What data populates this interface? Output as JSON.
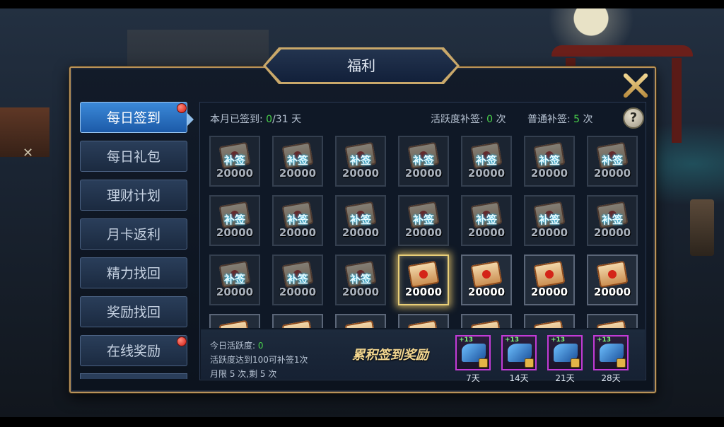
{
  "title": "福利",
  "sidebar": {
    "items": [
      {
        "label": "每日签到",
        "active": true,
        "red_dot": true
      },
      {
        "label": "每日礼包",
        "active": false,
        "red_dot": false
      },
      {
        "label": "理财计划",
        "active": false,
        "red_dot": false
      },
      {
        "label": "月卡返利",
        "active": false,
        "red_dot": false
      },
      {
        "label": "精力找回",
        "active": false,
        "red_dot": false
      },
      {
        "label": "奖励找回",
        "active": false,
        "red_dot": false
      },
      {
        "label": "在线奖励",
        "active": false,
        "red_dot": true
      }
    ]
  },
  "header": {
    "signed_label": "本月已签到:",
    "signed_value": "0",
    "signed_suffix": "/31 天",
    "activity_label": "活跃度补签:",
    "activity_value": "0",
    "activity_unit": "次",
    "normal_label": "普通补签:",
    "normal_value": "5",
    "normal_unit": "次",
    "help": "?"
  },
  "calendar": {
    "missed_overlay": "补签",
    "cells": [
      {
        "amount": "20000",
        "state": "missed"
      },
      {
        "amount": "20000",
        "state": "missed"
      },
      {
        "amount": "20000",
        "state": "missed"
      },
      {
        "amount": "20000",
        "state": "missed"
      },
      {
        "amount": "20000",
        "state": "missed"
      },
      {
        "amount": "20000",
        "state": "missed"
      },
      {
        "amount": "20000",
        "state": "missed"
      },
      {
        "amount": "20000",
        "state": "missed"
      },
      {
        "amount": "20000",
        "state": "missed"
      },
      {
        "amount": "20000",
        "state": "missed"
      },
      {
        "amount": "20000",
        "state": "missed"
      },
      {
        "amount": "20000",
        "state": "missed"
      },
      {
        "amount": "20000",
        "state": "missed"
      },
      {
        "amount": "20000",
        "state": "missed"
      },
      {
        "amount": "20000",
        "state": "missed"
      },
      {
        "amount": "20000",
        "state": "missed"
      },
      {
        "amount": "20000",
        "state": "missed"
      },
      {
        "amount": "20000",
        "state": "today"
      },
      {
        "amount": "20000",
        "state": "future"
      },
      {
        "amount": "20000",
        "state": "future"
      },
      {
        "amount": "20000",
        "state": "future"
      },
      {
        "amount": "",
        "state": "future"
      },
      {
        "amount": "",
        "state": "future"
      },
      {
        "amount": "",
        "state": "future"
      },
      {
        "amount": "",
        "state": "future"
      },
      {
        "amount": "",
        "state": "future"
      },
      {
        "amount": "",
        "state": "future"
      },
      {
        "amount": "",
        "state": "future"
      }
    ]
  },
  "bottom": {
    "today_activity_label": "今日活跃度:",
    "today_activity_value": "0",
    "rule_text": "活跃度达到100可补签1次",
    "limit_text": "月限 5 次,剩 5 次",
    "cumulative_label": "累积签到奖励",
    "rewards": [
      {
        "day": "7天",
        "plus": "+13"
      },
      {
        "day": "14天",
        "plus": "+13"
      },
      {
        "day": "21天",
        "plus": "+13"
      },
      {
        "day": "28天",
        "plus": "+13"
      }
    ]
  },
  "colors": {
    "accent_green": "#49d14b",
    "gold_border": "#b9935a",
    "active_blue": "#2f7fd0"
  }
}
